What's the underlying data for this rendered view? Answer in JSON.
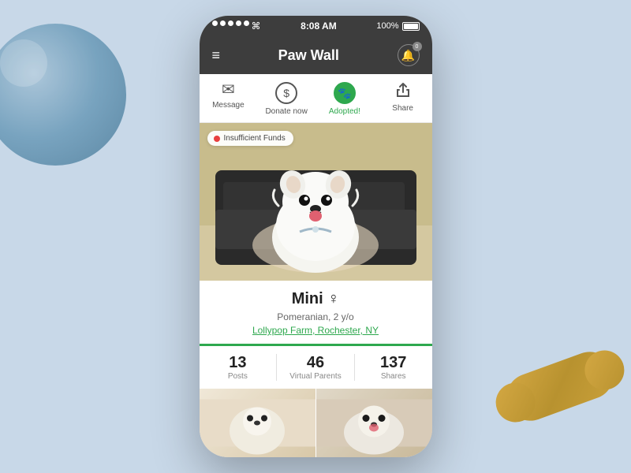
{
  "background": {
    "color": "#c8d8e8"
  },
  "status_bar": {
    "dots": [
      1,
      2,
      3,
      4,
      5
    ],
    "wifi": "wifi",
    "time": "8:08 AM",
    "battery_percent": "100%"
  },
  "header": {
    "title": "Paw Wall",
    "menu_icon": "≡",
    "bell_badge": "0"
  },
  "actions": [
    {
      "id": "message",
      "label": "Message",
      "icon": "✉",
      "type": "envelope",
      "active": false
    },
    {
      "id": "donate",
      "label": "Donate now",
      "icon": "$",
      "type": "circle",
      "active": false
    },
    {
      "id": "adopted",
      "label": "Adopted!",
      "icon": "🐾",
      "type": "heart-paw",
      "active": true
    },
    {
      "id": "share",
      "label": "Share",
      "icon": "⬆",
      "type": "share",
      "active": false
    }
  ],
  "funds_badge": {
    "label": "Insufficient Funds"
  },
  "pet": {
    "name": "Mini ♀",
    "breed": "Pomeranian, 2 y/o",
    "location": "Lollypop Farm, Rochester, NY"
  },
  "stats": [
    {
      "value": "13",
      "label": "Posts"
    },
    {
      "value": "46",
      "label": "Virtual Parents"
    },
    {
      "value": "137",
      "label": "Shares"
    }
  ]
}
